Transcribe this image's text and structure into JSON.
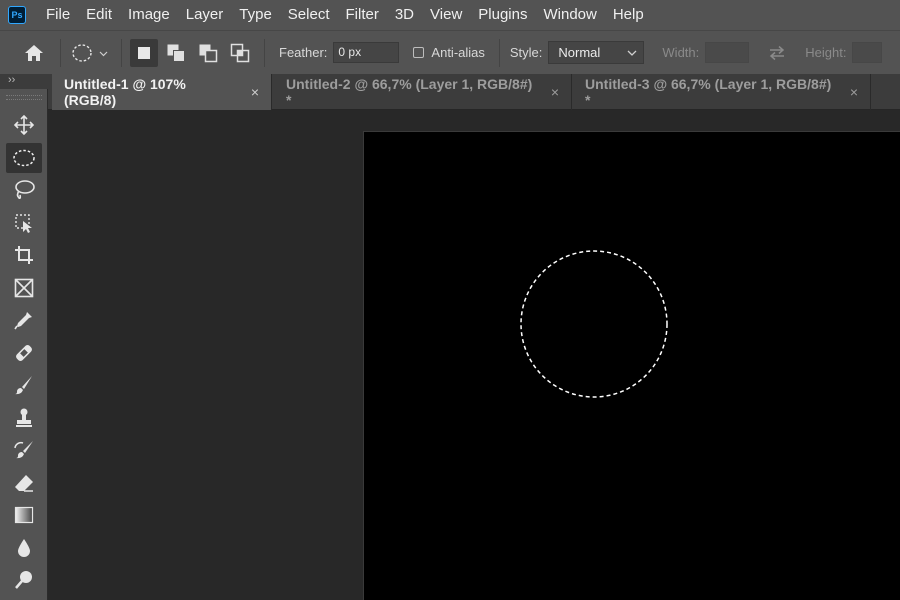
{
  "app": {
    "logo_text": "Ps",
    "accent": "#31a8ff"
  },
  "menu": [
    "File",
    "Edit",
    "Image",
    "Layer",
    "Type",
    "Select",
    "Filter",
    "3D",
    "View",
    "Plugins",
    "Window",
    "Help"
  ],
  "options": {
    "feather_label": "Feather:",
    "feather_value": "0 px",
    "antialias_label": "Anti-alias",
    "antialias_checked": false,
    "style_label": "Style:",
    "style_value": "Normal",
    "width_label": "Width:",
    "width_value": "",
    "height_label": "Height:",
    "height_value": ""
  },
  "tabs": [
    {
      "title": "Untitled-1 @ 107% (RGB/8)",
      "close": "×",
      "active": true
    },
    {
      "title": "Untitled-2 @ 66,7% (Layer 1, RGB/8#) *",
      "close": "×",
      "active": false
    },
    {
      "title": "Untitled-3 @ 66,7% (Layer 1, RGB/8#) *",
      "close": "×",
      "active": false
    }
  ],
  "toolbar": {
    "collapse_glyph": "››",
    "tools": [
      "move-tool",
      "elliptical-marquee-tool",
      "lasso-tool",
      "object-selection-tool",
      "crop-tool",
      "frame-tool",
      "eyedropper-tool",
      "healing-brush-tool",
      "brush-tool",
      "clone-stamp-tool",
      "history-brush-tool",
      "eraser-tool",
      "gradient-tool",
      "blur-tool",
      "dodge-tool"
    ],
    "active_tool": "elliptical-marquee-tool"
  },
  "document": {
    "background_color": "#000000",
    "selection_shape": "ellipse"
  }
}
